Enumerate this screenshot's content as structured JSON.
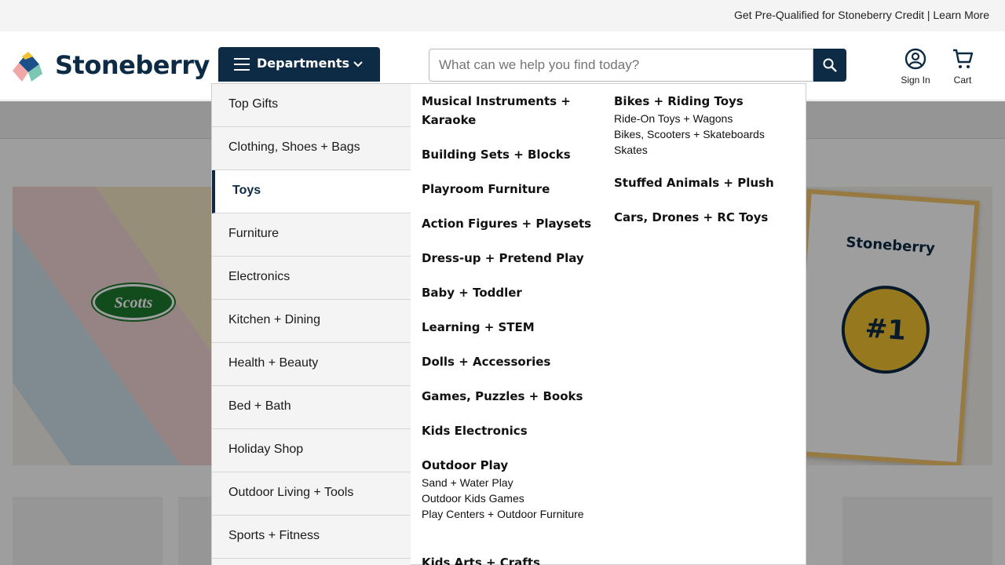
{
  "topbar": {
    "credit_link": "Get Pre-Qualified for Stoneberry Credit | Learn More"
  },
  "header": {
    "logo_text": "Stoneberry",
    "departments_label": "Departments",
    "search_placeholder": "What can we help you find today?",
    "sign_in_label": "Sign In",
    "cart_label": "Cart"
  },
  "colors": {
    "brand_navy": "#0d2b45",
    "brand_gold": "#f2c231"
  },
  "menu": {
    "departments": [
      {
        "label": "Top Gifts"
      },
      {
        "label": "Clothing, Shoes + Bags"
      },
      {
        "label": "Toys"
      },
      {
        "label": "Furniture"
      },
      {
        "label": "Electronics"
      },
      {
        "label": "Kitchen + Dining"
      },
      {
        "label": "Health + Beauty"
      },
      {
        "label": "Bed + Bath"
      },
      {
        "label": "Holiday Shop"
      },
      {
        "label": "Outdoor Living + Tools"
      },
      {
        "label": "Sports + Fitness"
      }
    ],
    "active_department": "Toys",
    "column1": [
      {
        "label": "Musical Instruments + Karaoke",
        "subs": []
      },
      {
        "label": "Building Sets + Blocks",
        "subs": []
      },
      {
        "label": "Playroom Furniture",
        "subs": []
      },
      {
        "label": "Action Figures + Playsets",
        "subs": []
      },
      {
        "label": "Dress-up + Pretend Play",
        "subs": []
      },
      {
        "label": "Baby + Toddler",
        "subs": []
      },
      {
        "label": "Learning + STEM",
        "subs": []
      },
      {
        "label": "Dolls + Accessories",
        "subs": []
      },
      {
        "label": "Games, Puzzles + Books",
        "subs": []
      },
      {
        "label": "Kids Electronics",
        "subs": []
      },
      {
        "label": "Outdoor Play",
        "subs": [
          "Sand + Water Play",
          "Outdoor Kids Games",
          "Play Centers + Outdoor Furniture"
        ]
      },
      {
        "label": "Kids Arts + Crafts",
        "subs": []
      }
    ],
    "column2": [
      {
        "label": "Bikes + Riding Toys",
        "subs": [
          "Ride-On Toys + Wagons",
          "Bikes, Scooters + Skateboards",
          "Skates"
        ]
      },
      {
        "label": "Stuffed Animals + Plush",
        "subs": []
      },
      {
        "label": "Cars, Drones + RC Toys",
        "subs": []
      }
    ]
  },
  "hero": {
    "brand_badge": "Scotts",
    "card_logo": "Stoneberry",
    "card_badge": "#1"
  }
}
